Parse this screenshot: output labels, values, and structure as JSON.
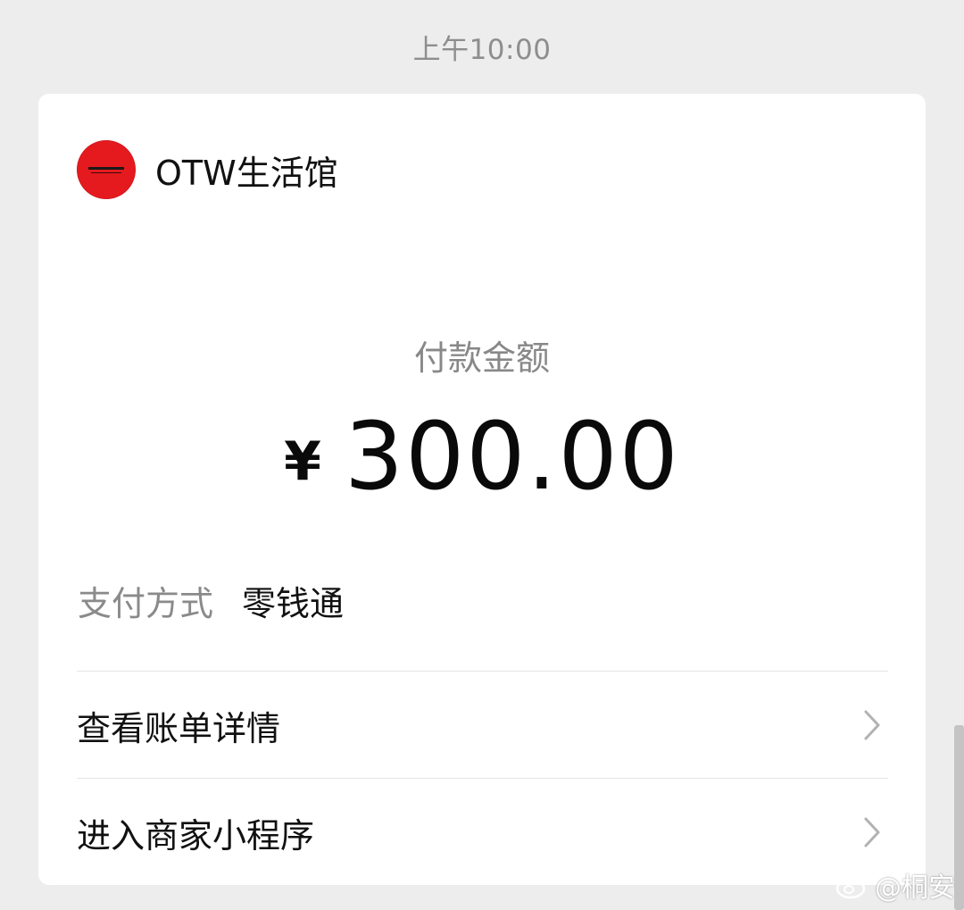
{
  "message_time": "上午10:00",
  "merchant": {
    "name": "OTW生活馆",
    "logo_icon": "merchant-logo-icon",
    "logo_color": "#e51a1f"
  },
  "payment": {
    "amount_label": "付款金额",
    "currency_symbol": "¥",
    "amount": "300.00",
    "method_label": "支付方式",
    "method_value": "零钱通"
  },
  "actions": [
    {
      "label": "查看账单详情",
      "icon": "chevron-right-icon"
    },
    {
      "label": "进入商家小程序",
      "icon": "chevron-right-icon"
    }
  ],
  "watermark": {
    "icon": "weibo-icon",
    "text": "@桐安"
  }
}
